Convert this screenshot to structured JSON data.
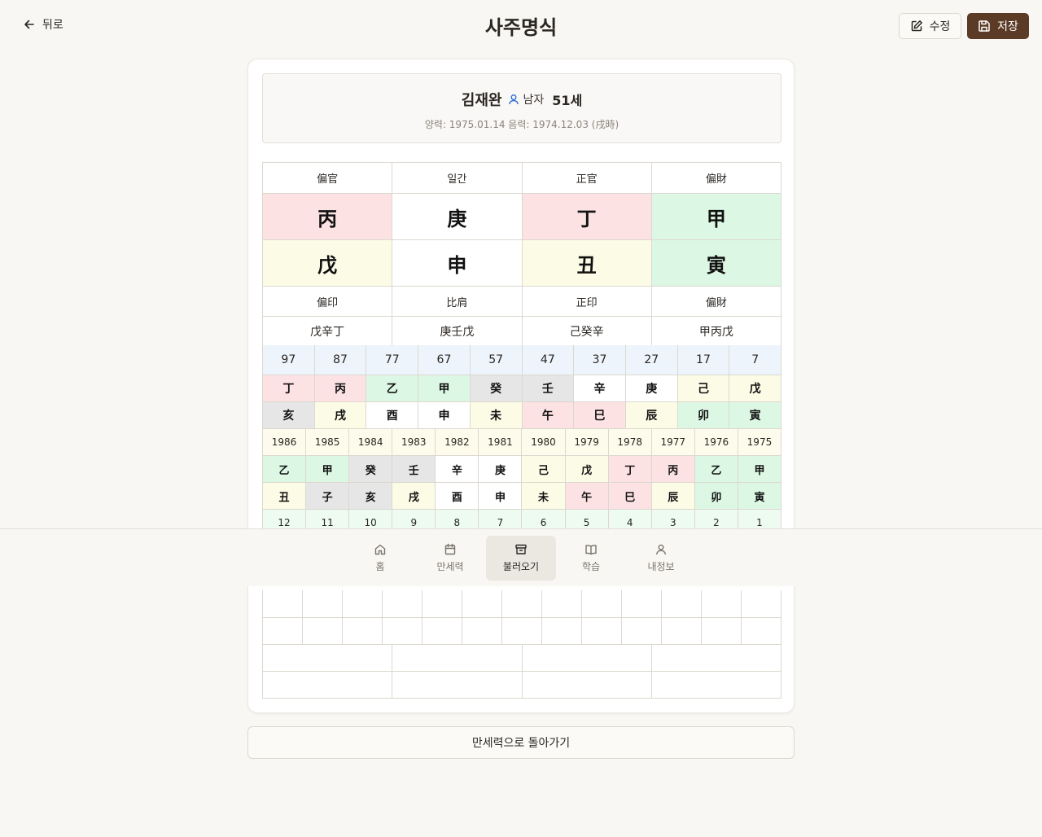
{
  "header": {
    "back_label": "뒤로",
    "title": "사주명식",
    "edit_label": "수정",
    "save_label": "저장"
  },
  "profile": {
    "name": "김재완",
    "gender": "남자",
    "age": "51세",
    "dates": "양력: 1975.01.14 음력: 1974.12.03 (戌時)"
  },
  "colors": {
    "fire": "#fde2e3",
    "earth": "#fbfbe6",
    "wood": "#dcf8e4",
    "metal": "#ffffff",
    "water": "#e6e6e6",
    "save_button": "#5b3a26",
    "gender_icon": "#2f6fd6"
  },
  "pillars": [
    {
      "top_label": "偏官",
      "stem": "丙",
      "stem_el": "fire",
      "branch": "戊",
      "branch_el": "earth",
      "bottom_label": "偏印",
      "hidden": "戊辛丁"
    },
    {
      "top_label": "일간",
      "stem": "庚",
      "stem_el": "metal",
      "branch": "申",
      "branch_el": "metal",
      "bottom_label": "比肩",
      "hidden": "庚壬戊"
    },
    {
      "top_label": "正官",
      "stem": "丁",
      "stem_el": "fire",
      "branch": "丑",
      "branch_el": "earth",
      "bottom_label": "正印",
      "hidden": "己癸辛"
    },
    {
      "top_label": "偏財",
      "stem": "甲",
      "stem_el": "wood",
      "branch": "寅",
      "branch_el": "wood",
      "bottom_label": "偏財",
      "hidden": "甲丙戊"
    }
  ],
  "daeun": {
    "ages": [
      "97",
      "87",
      "77",
      "67",
      "57",
      "47",
      "37",
      "27",
      "17",
      "7"
    ],
    "stems": [
      "丁",
      "丙",
      "乙",
      "甲",
      "癸",
      "壬",
      "辛",
      "庚",
      "己",
      "戊"
    ],
    "stem_els": [
      "fire",
      "fire",
      "wood",
      "wood",
      "water",
      "water",
      "metal",
      "metal",
      "earth",
      "earth"
    ],
    "branches": [
      "亥",
      "戌",
      "酉",
      "申",
      "未",
      "午",
      "巳",
      "辰",
      "卯",
      "寅"
    ],
    "branch_els": [
      "water",
      "earth",
      "metal",
      "metal",
      "earth",
      "fire",
      "fire",
      "earth",
      "wood",
      "wood"
    ]
  },
  "seun": {
    "years": [
      "1986",
      "1985",
      "1984",
      "1983",
      "1982",
      "1981",
      "1980",
      "1979",
      "1978",
      "1977",
      "1976",
      "1975"
    ],
    "stems": [
      "乙",
      "甲",
      "癸",
      "壬",
      "辛",
      "庚",
      "己",
      "戊",
      "丁",
      "丙",
      "乙",
      "甲"
    ],
    "stem_els": [
      "wood",
      "wood",
      "water",
      "water",
      "metal",
      "metal",
      "earth",
      "earth",
      "fire",
      "fire",
      "wood",
      "wood"
    ],
    "branches": [
      "丑",
      "子",
      "亥",
      "戌",
      "酉",
      "申",
      "未",
      "午",
      "巳",
      "辰",
      "卯",
      "寅"
    ],
    "branch_els": [
      "earth",
      "water",
      "water",
      "earth",
      "metal",
      "metal",
      "earth",
      "fire",
      "fire",
      "earth",
      "wood",
      "wood"
    ],
    "numbers": [
      "12",
      "11",
      "10",
      "9",
      "8",
      "7",
      "6",
      "5",
      "4",
      "3",
      "2",
      "1"
    ]
  },
  "nav": [
    {
      "label": "홈",
      "icon": "home-icon"
    },
    {
      "label": "만세력",
      "icon": "calendar-icon"
    },
    {
      "label": "불러오기",
      "icon": "archive-icon",
      "active": true
    },
    {
      "label": "학습",
      "icon": "book-icon"
    },
    {
      "label": "내정보",
      "icon": "user-icon"
    }
  ],
  "return_button_label": "만세력으로 돌아가기"
}
